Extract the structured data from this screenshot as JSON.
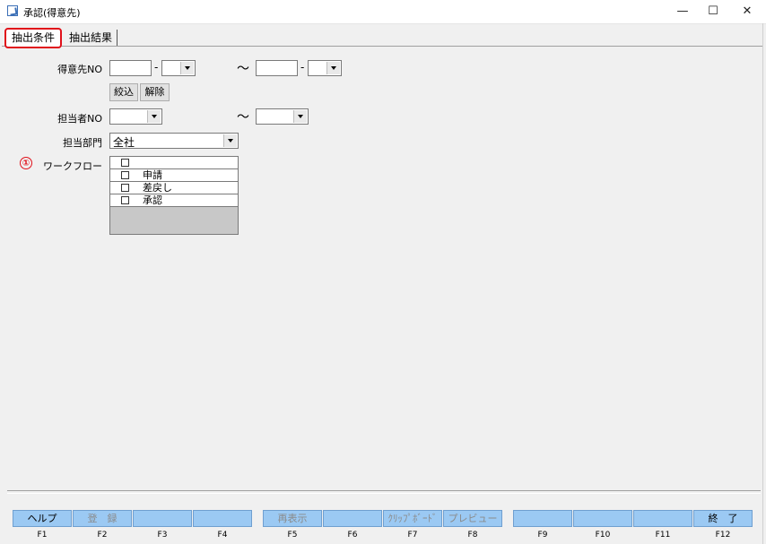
{
  "window": {
    "title": "承認(得意先)",
    "minimize": "—",
    "maximize": "☐",
    "close": "✕"
  },
  "tabs": [
    {
      "label": "抽出条件",
      "active": true
    },
    {
      "label": "抽出結果",
      "active": false
    }
  ],
  "form": {
    "customer_no_label": "得意先NO",
    "dash": "-",
    "tilde": "～",
    "narrow_button": "絞込",
    "clear_button": "解除",
    "staff_no_label": "担当者NO",
    "department_label": "担当部門",
    "department_value": "全社",
    "workflow_marker": "①",
    "workflow_label": "ワークフロー",
    "workflow_options": [
      "",
      "申請",
      "差戻し",
      "承認"
    ]
  },
  "function_keys": [
    {
      "label": "ヘルプ",
      "key": "F1",
      "enabled": true
    },
    {
      "label": "登　録",
      "key": "F2",
      "enabled": false
    },
    {
      "label": "",
      "key": "F3",
      "enabled": false
    },
    {
      "label": "",
      "key": "F4",
      "enabled": false
    },
    {
      "label": "再表示",
      "key": "F5",
      "enabled": false
    },
    {
      "label": "",
      "key": "F6",
      "enabled": false
    },
    {
      "label": "ｸﾘｯﾌﾟﾎﾞｰﾄﾞ",
      "key": "F7",
      "enabled": false
    },
    {
      "label": "プレビュー",
      "key": "F8",
      "enabled": false
    },
    {
      "label": "",
      "key": "F9",
      "enabled": false
    },
    {
      "label": "",
      "key": "F10",
      "enabled": false
    },
    {
      "label": "",
      "key": "F11",
      "enabled": false
    },
    {
      "label": "終　了",
      "key": "F12",
      "enabled": true
    }
  ],
  "colors": {
    "fkey_bg": "#9bc9f3",
    "highlight_red": "#e0101a"
  }
}
